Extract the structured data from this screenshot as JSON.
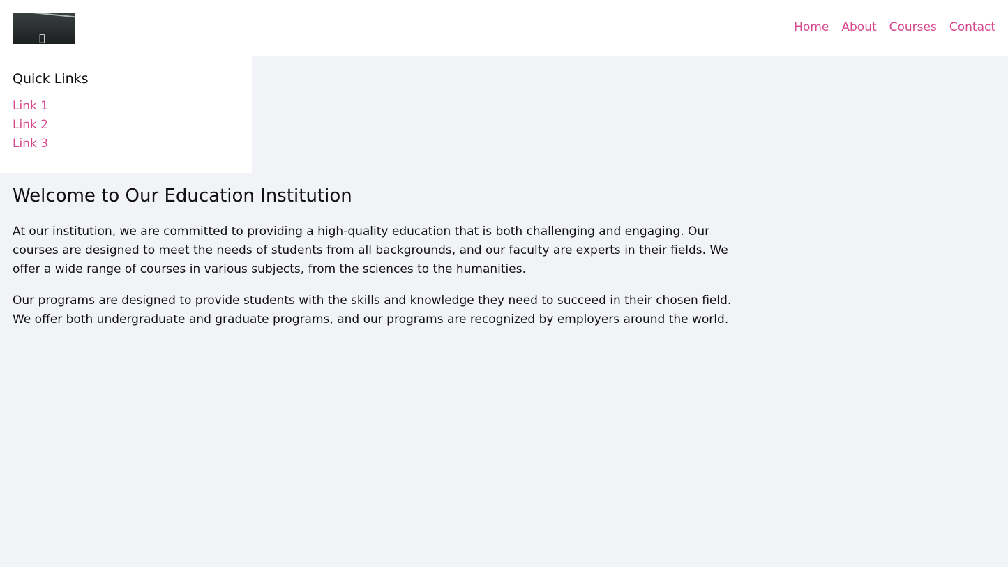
{
  "header": {
    "logo_icon": "apple-icon",
    "nav": [
      "Home",
      "About",
      "Courses",
      "Contact"
    ]
  },
  "sidebar": {
    "title": "Quick Links",
    "links": [
      "Link 1",
      "Link 2",
      "Link 3"
    ]
  },
  "main": {
    "title": "Welcome to Our Education Institution",
    "paragraphs": [
      "At our institution, we are committed to providing a high-quality education that is both challenging and engaging. Our courses are designed to meet the needs of students from all backgrounds, and our faculty are experts in their fields. We offer a wide range of courses in various subjects, from the sciences to the humanities.",
      "Our programs are designed to provide students with the skills and knowledge they need to succeed in their chosen field. We offer both undergraduate and graduate programs, and our programs are recognized by employers around the world."
    ]
  },
  "colors": {
    "accent": "#d6478e",
    "page_background": "#f2f3f6",
    "panel_background": "#ffffff"
  }
}
